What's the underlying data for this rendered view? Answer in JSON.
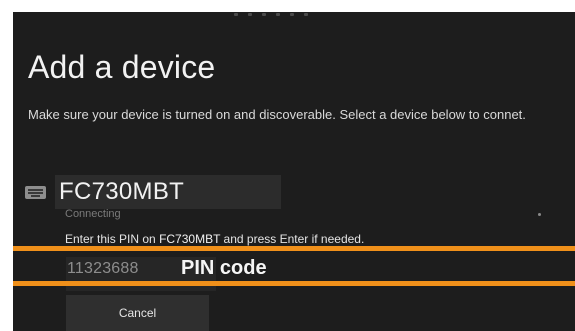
{
  "dialog": {
    "title": "Add a device",
    "description": "Make sure your device is turned on and discoverable. Select a device below to connet."
  },
  "device": {
    "icon": "keyboard-icon",
    "name": "FC730MBT",
    "status": "Connecting"
  },
  "pin": {
    "instruction_prefix": "Enter this PIN on",
    "instruction_device": "FC730MBT",
    "instruction_suffix": "and press Enter if needed.",
    "value": "11323688",
    "annotation_label": "PIN code",
    "highlight_color": "#f0901a"
  },
  "actions": {
    "cancel_label": "Cancel"
  }
}
